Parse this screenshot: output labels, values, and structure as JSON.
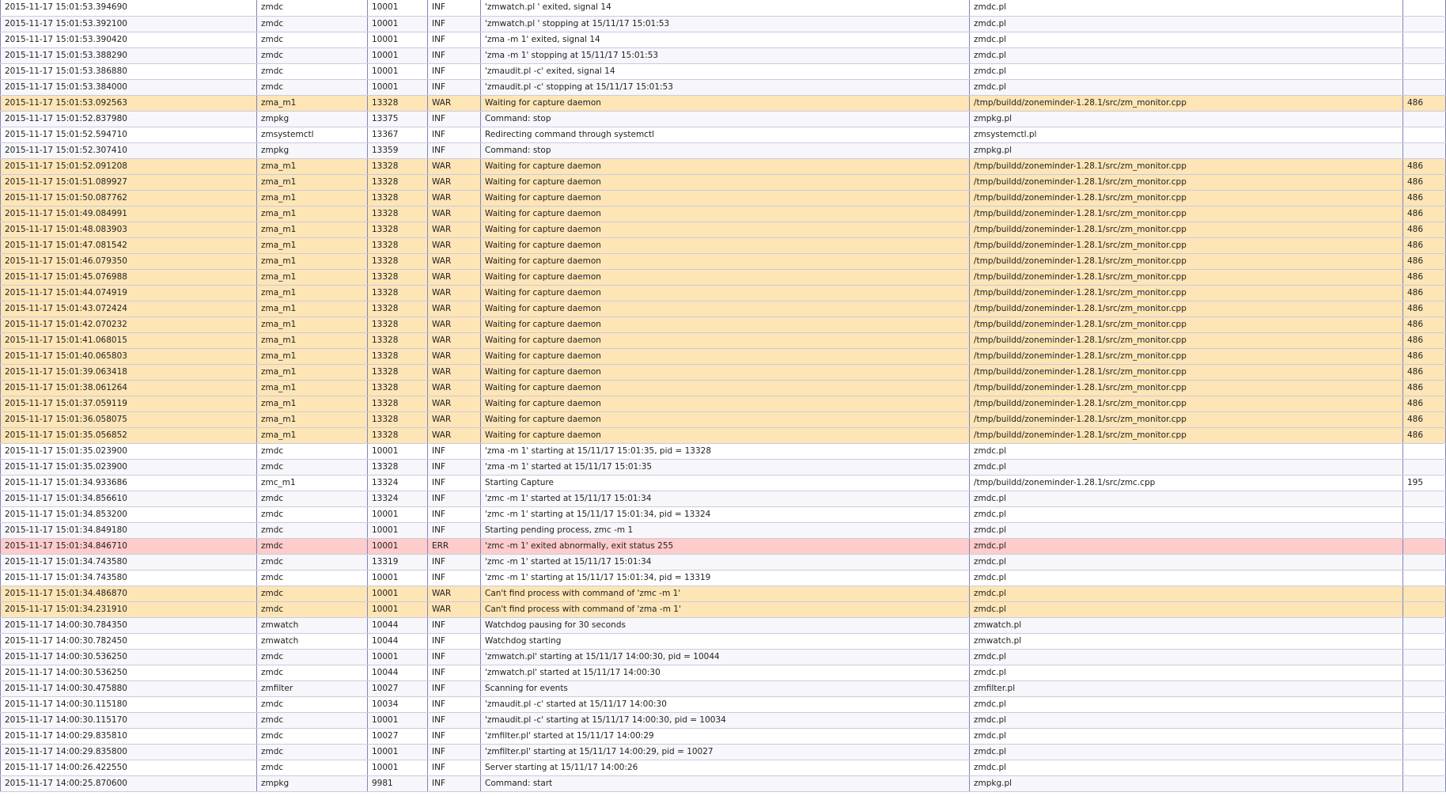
{
  "colors": {
    "info_row": "#ffffff",
    "info_row_alt": "#f7f7fb",
    "warning_row": "#fde5b6",
    "error_row": "#ffcccc",
    "border": "#7f86b8"
  },
  "log": {
    "rows": [
      {
        "time": "2015-11-17 15:01:53.394690",
        "component": "zmdc",
        "pid": "10001",
        "level": "INF",
        "message": "'zmwatch.pl ' exited, signal 14",
        "file": "zmdc.pl",
        "line": ""
      },
      {
        "time": "2015-11-17 15:01:53.392100",
        "component": "zmdc",
        "pid": "10001",
        "level": "INF",
        "message": "'zmwatch.pl ' stopping at 15/11/17 15:01:53",
        "file": "zmdc.pl",
        "line": ""
      },
      {
        "time": "2015-11-17 15:01:53.390420",
        "component": "zmdc",
        "pid": "10001",
        "level": "INF",
        "message": "'zma -m 1' exited, signal 14",
        "file": "zmdc.pl",
        "line": ""
      },
      {
        "time": "2015-11-17 15:01:53.388290",
        "component": "zmdc",
        "pid": "10001",
        "level": "INF",
        "message": "'zma -m 1' stopping at 15/11/17 15:01:53",
        "file": "zmdc.pl",
        "line": ""
      },
      {
        "time": "2015-11-17 15:01:53.386880",
        "component": "zmdc",
        "pid": "10001",
        "level": "INF",
        "message": "'zmaudit.pl -c' exited, signal 14",
        "file": "zmdc.pl",
        "line": ""
      },
      {
        "time": "2015-11-17 15:01:53.384000",
        "component": "zmdc",
        "pid": "10001",
        "level": "INF",
        "message": "'zmaudit.pl -c' stopping at 15/11/17 15:01:53",
        "file": "zmdc.pl",
        "line": ""
      },
      {
        "time": "2015-11-17 15:01:53.092563",
        "component": "zma_m1",
        "pid": "13328",
        "level": "WAR",
        "message": "Waiting for capture daemon",
        "file": "/tmp/buildd/zoneminder-1.28.1/src/zm_monitor.cpp",
        "line": "486"
      },
      {
        "time": "2015-11-17 15:01:52.837980",
        "component": "zmpkg",
        "pid": "13375",
        "level": "INF",
        "message": "Command: stop",
        "file": "zmpkg.pl",
        "line": ""
      },
      {
        "time": "2015-11-17 15:01:52.594710",
        "component": "zmsystemctl",
        "pid": "13367",
        "level": "INF",
        "message": "Redirecting command through systemctl",
        "file": "zmsystemctl.pl",
        "line": ""
      },
      {
        "time": "2015-11-17 15:01:52.307410",
        "component": "zmpkg",
        "pid": "13359",
        "level": "INF",
        "message": "Command: stop",
        "file": "zmpkg.pl",
        "line": ""
      },
      {
        "time": "2015-11-17 15:01:52.091208",
        "component": "zma_m1",
        "pid": "13328",
        "level": "WAR",
        "message": "Waiting for capture daemon",
        "file": "/tmp/buildd/zoneminder-1.28.1/src/zm_monitor.cpp",
        "line": "486"
      },
      {
        "time": "2015-11-17 15:01:51.089927",
        "component": "zma_m1",
        "pid": "13328",
        "level": "WAR",
        "message": "Waiting for capture daemon",
        "file": "/tmp/buildd/zoneminder-1.28.1/src/zm_monitor.cpp",
        "line": "486"
      },
      {
        "time": "2015-11-17 15:01:50.087762",
        "component": "zma_m1",
        "pid": "13328",
        "level": "WAR",
        "message": "Waiting for capture daemon",
        "file": "/tmp/buildd/zoneminder-1.28.1/src/zm_monitor.cpp",
        "line": "486"
      },
      {
        "time": "2015-11-17 15:01:49.084991",
        "component": "zma_m1",
        "pid": "13328",
        "level": "WAR",
        "message": "Waiting for capture daemon",
        "file": "/tmp/buildd/zoneminder-1.28.1/src/zm_monitor.cpp",
        "line": "486"
      },
      {
        "time": "2015-11-17 15:01:48.083903",
        "component": "zma_m1",
        "pid": "13328",
        "level": "WAR",
        "message": "Waiting for capture daemon",
        "file": "/tmp/buildd/zoneminder-1.28.1/src/zm_monitor.cpp",
        "line": "486"
      },
      {
        "time": "2015-11-17 15:01:47.081542",
        "component": "zma_m1",
        "pid": "13328",
        "level": "WAR",
        "message": "Waiting for capture daemon",
        "file": "/tmp/buildd/zoneminder-1.28.1/src/zm_monitor.cpp",
        "line": "486"
      },
      {
        "time": "2015-11-17 15:01:46.079350",
        "component": "zma_m1",
        "pid": "13328",
        "level": "WAR",
        "message": "Waiting for capture daemon",
        "file": "/tmp/buildd/zoneminder-1.28.1/src/zm_monitor.cpp",
        "line": "486"
      },
      {
        "time": "2015-11-17 15:01:45.076988",
        "component": "zma_m1",
        "pid": "13328",
        "level": "WAR",
        "message": "Waiting for capture daemon",
        "file": "/tmp/buildd/zoneminder-1.28.1/src/zm_monitor.cpp",
        "line": "486"
      },
      {
        "time": "2015-11-17 15:01:44.074919",
        "component": "zma_m1",
        "pid": "13328",
        "level": "WAR",
        "message": "Waiting for capture daemon",
        "file": "/tmp/buildd/zoneminder-1.28.1/src/zm_monitor.cpp",
        "line": "486"
      },
      {
        "time": "2015-11-17 15:01:43.072424",
        "component": "zma_m1",
        "pid": "13328",
        "level": "WAR",
        "message": "Waiting for capture daemon",
        "file": "/tmp/buildd/zoneminder-1.28.1/src/zm_monitor.cpp",
        "line": "486"
      },
      {
        "time": "2015-11-17 15:01:42.070232",
        "component": "zma_m1",
        "pid": "13328",
        "level": "WAR",
        "message": "Waiting for capture daemon",
        "file": "/tmp/buildd/zoneminder-1.28.1/src/zm_monitor.cpp",
        "line": "486"
      },
      {
        "time": "2015-11-17 15:01:41.068015",
        "component": "zma_m1",
        "pid": "13328",
        "level": "WAR",
        "message": "Waiting for capture daemon",
        "file": "/tmp/buildd/zoneminder-1.28.1/src/zm_monitor.cpp",
        "line": "486"
      },
      {
        "time": "2015-11-17 15:01:40.065803",
        "component": "zma_m1",
        "pid": "13328",
        "level": "WAR",
        "message": "Waiting for capture daemon",
        "file": "/tmp/buildd/zoneminder-1.28.1/src/zm_monitor.cpp",
        "line": "486"
      },
      {
        "time": "2015-11-17 15:01:39.063418",
        "component": "zma_m1",
        "pid": "13328",
        "level": "WAR",
        "message": "Waiting for capture daemon",
        "file": "/tmp/buildd/zoneminder-1.28.1/src/zm_monitor.cpp",
        "line": "486"
      },
      {
        "time": "2015-11-17 15:01:38.061264",
        "component": "zma_m1",
        "pid": "13328",
        "level": "WAR",
        "message": "Waiting for capture daemon",
        "file": "/tmp/buildd/zoneminder-1.28.1/src/zm_monitor.cpp",
        "line": "486"
      },
      {
        "time": "2015-11-17 15:01:37.059119",
        "component": "zma_m1",
        "pid": "13328",
        "level": "WAR",
        "message": "Waiting for capture daemon",
        "file": "/tmp/buildd/zoneminder-1.28.1/src/zm_monitor.cpp",
        "line": "486"
      },
      {
        "time": "2015-11-17 15:01:36.058075",
        "component": "zma_m1",
        "pid": "13328",
        "level": "WAR",
        "message": "Waiting for capture daemon",
        "file": "/tmp/buildd/zoneminder-1.28.1/src/zm_monitor.cpp",
        "line": "486"
      },
      {
        "time": "2015-11-17 15:01:35.056852",
        "component": "zma_m1",
        "pid": "13328",
        "level": "WAR",
        "message": "Waiting for capture daemon",
        "file": "/tmp/buildd/zoneminder-1.28.1/src/zm_monitor.cpp",
        "line": "486"
      },
      {
        "time": "2015-11-17 15:01:35.023900",
        "component": "zmdc",
        "pid": "10001",
        "level": "INF",
        "message": "'zma -m 1' starting at 15/11/17 15:01:35, pid = 13328",
        "file": "zmdc.pl",
        "line": ""
      },
      {
        "time": "2015-11-17 15:01:35.023900",
        "component": "zmdc",
        "pid": "13328",
        "level": "INF",
        "message": "'zma -m 1' started at 15/11/17 15:01:35",
        "file": "zmdc.pl",
        "line": ""
      },
      {
        "time": "2015-11-17 15:01:34.933686",
        "component": "zmc_m1",
        "pid": "13324",
        "level": "INF",
        "message": "Starting Capture",
        "file": "/tmp/buildd/zoneminder-1.28.1/src/zmc.cpp",
        "line": "195"
      },
      {
        "time": "2015-11-17 15:01:34.856610",
        "component": "zmdc",
        "pid": "13324",
        "level": "INF",
        "message": "'zmc -m 1' started at 15/11/17 15:01:34",
        "file": "zmdc.pl",
        "line": ""
      },
      {
        "time": "2015-11-17 15:01:34.853200",
        "component": "zmdc",
        "pid": "10001",
        "level": "INF",
        "message": "'zmc -m 1' starting at 15/11/17 15:01:34, pid = 13324",
        "file": "zmdc.pl",
        "line": ""
      },
      {
        "time": "2015-11-17 15:01:34.849180",
        "component": "zmdc",
        "pid": "10001",
        "level": "INF",
        "message": "Starting pending process, zmc -m 1",
        "file": "zmdc.pl",
        "line": ""
      },
      {
        "time": "2015-11-17 15:01:34.846710",
        "component": "zmdc",
        "pid": "10001",
        "level": "ERR",
        "message": "'zmc -m 1' exited abnormally, exit status 255",
        "file": "zmdc.pl",
        "line": ""
      },
      {
        "time": "2015-11-17 15:01:34.743580",
        "component": "zmdc",
        "pid": "13319",
        "level": "INF",
        "message": "'zmc -m 1' started at 15/11/17 15:01:34",
        "file": "zmdc.pl",
        "line": ""
      },
      {
        "time": "2015-11-17 15:01:34.743580",
        "component": "zmdc",
        "pid": "10001",
        "level": "INF",
        "message": "'zmc -m 1' starting at 15/11/17 15:01:34, pid = 13319",
        "file": "zmdc.pl",
        "line": ""
      },
      {
        "time": "2015-11-17 15:01:34.486870",
        "component": "zmdc",
        "pid": "10001",
        "level": "WAR",
        "message": "Can't find process with command of 'zmc -m 1'",
        "file": "zmdc.pl",
        "line": ""
      },
      {
        "time": "2015-11-17 15:01:34.231910",
        "component": "zmdc",
        "pid": "10001",
        "level": "WAR",
        "message": "Can't find process with command of 'zma -m 1'",
        "file": "zmdc.pl",
        "line": ""
      },
      {
        "time": "2015-11-17 14:00:30.784350",
        "component": "zmwatch",
        "pid": "10044",
        "level": "INF",
        "message": "Watchdog pausing for 30 seconds",
        "file": "zmwatch.pl",
        "line": ""
      },
      {
        "time": "2015-11-17 14:00:30.782450",
        "component": "zmwatch",
        "pid": "10044",
        "level": "INF",
        "message": "Watchdog starting",
        "file": "zmwatch.pl",
        "line": ""
      },
      {
        "time": "2015-11-17 14:00:30.536250",
        "component": "zmdc",
        "pid": "10001",
        "level": "INF",
        "message": "'zmwatch.pl' starting at 15/11/17 14:00:30, pid = 10044",
        "file": "zmdc.pl",
        "line": ""
      },
      {
        "time": "2015-11-17 14:00:30.536250",
        "component": "zmdc",
        "pid": "10044",
        "level": "INF",
        "message": "'zmwatch.pl' started at 15/11/17 14:00:30",
        "file": "zmdc.pl",
        "line": ""
      },
      {
        "time": "2015-11-17 14:00:30.475880",
        "component": "zmfilter",
        "pid": "10027",
        "level": "INF",
        "message": "Scanning for events",
        "file": "zmfilter.pl",
        "line": ""
      },
      {
        "time": "2015-11-17 14:00:30.115180",
        "component": "zmdc",
        "pid": "10034",
        "level": "INF",
        "message": "'zmaudit.pl -c' started at 15/11/17 14:00:30",
        "file": "zmdc.pl",
        "line": ""
      },
      {
        "time": "2015-11-17 14:00:30.115170",
        "component": "zmdc",
        "pid": "10001",
        "level": "INF",
        "message": "'zmaudit.pl -c' starting at 15/11/17 14:00:30, pid = 10034",
        "file": "zmdc.pl",
        "line": ""
      },
      {
        "time": "2015-11-17 14:00:29.835810",
        "component": "zmdc",
        "pid": "10027",
        "level": "INF",
        "message": "'zmfilter.pl' started at 15/11/17 14:00:29",
        "file": "zmdc.pl",
        "line": ""
      },
      {
        "time": "2015-11-17 14:00:29.835800",
        "component": "zmdc",
        "pid": "10001",
        "level": "INF",
        "message": "'zmfilter.pl' starting at 15/11/17 14:00:29, pid = 10027",
        "file": "zmdc.pl",
        "line": ""
      },
      {
        "time": "2015-11-17 14:00:26.422550",
        "component": "zmdc",
        "pid": "10001",
        "level": "INF",
        "message": "Server starting at 15/11/17 14:00:26",
        "file": "zmdc.pl",
        "line": ""
      },
      {
        "time": "2015-11-17 14:00:25.870600",
        "component": "zmpkg",
        "pid": "9981",
        "level": "INF",
        "message": "Command: start",
        "file": "zmpkg.pl",
        "line": ""
      }
    ]
  }
}
